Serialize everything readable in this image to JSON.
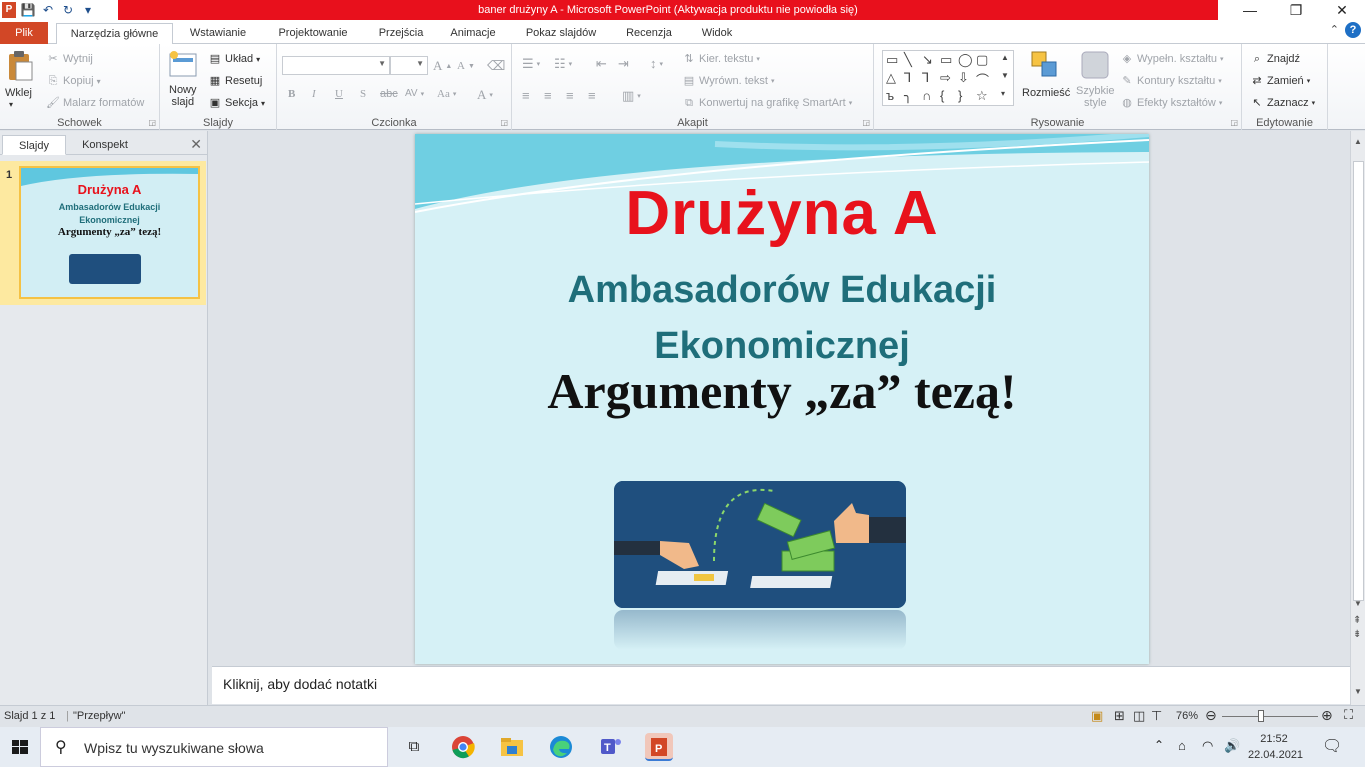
{
  "window": {
    "title": "baner drużyny A  -  Microsoft PowerPoint (Aktywacja produktu nie powiodła się)",
    "app_icon_letter": "P",
    "controls": {
      "minimize": "—",
      "restore": "❐",
      "close": "✕"
    }
  },
  "tabs": {
    "file": "Plik",
    "home": "Narzędzia główne",
    "insert": "Wstawianie",
    "design": "Projektowanie",
    "transitions": "Przejścia",
    "animations": "Animacje",
    "slideshow": "Pokaz slajdów",
    "review": "Recenzja",
    "view": "Widok"
  },
  "ribbon": {
    "clipboard": {
      "label": "Schowek",
      "paste": "Wklej",
      "cut": "Wytnij",
      "copy": "Kopiuj",
      "painter": "Malarz formatów"
    },
    "slides": {
      "label": "Slajdy",
      "new_slide_1": "Nowy",
      "new_slide_2": "slajd",
      "layout": "Układ",
      "reset": "Resetuj",
      "section": "Sekcja"
    },
    "font": {
      "label": "Czcionka",
      "bold": "B",
      "italic": "I",
      "underline": "U",
      "shadow": "S",
      "strike": "abc",
      "spacing": "AV",
      "case": "Aa",
      "grow": "A",
      "shrink": "A",
      "color": "A"
    },
    "paragraph": {
      "label": "Akapit",
      "text_direction": "Kier. tekstu",
      "align_text": "Wyrówn. tekst",
      "smartart": "Konwertuj na grafikę SmartArt"
    },
    "drawing": {
      "label": "Rysowanie",
      "arrange": "Rozmieść",
      "quick_styles_1": "Szybkie",
      "quick_styles_2": "style",
      "fill": "Wypełn. kształtu",
      "outline": "Kontury kształtu",
      "effects": "Efekty kształtów"
    },
    "editing": {
      "label": "Edytowanie",
      "find": "Znajdź",
      "replace": "Zamień",
      "select": "Zaznacz"
    }
  },
  "panel": {
    "tab_slides": "Slajdy",
    "tab_outline": "Konspekt",
    "close": "✕",
    "slide_number": "1"
  },
  "slide": {
    "title": "Drużyna  A",
    "subtitle_line1": "Ambasadorów Edukacji",
    "subtitle_line2": "Ekonomicznej",
    "argument": "Argumenty „za” tezą!"
  },
  "notes": {
    "placeholder": "Kliknij, aby dodać notatki"
  },
  "status": {
    "slide_count": "Slajd 1 z 1",
    "theme": "\"Przepływ\"",
    "zoom": "76%"
  },
  "taskbar": {
    "search_placeholder": "Wpisz tu wyszukiwane słowa",
    "time": "21:52",
    "date": "22.04.2021"
  },
  "colors": {
    "title_red": "#e8121c",
    "subtitle_teal": "#1f6e7a",
    "ppt_orange": "#d24726",
    "slide_bg": "#d6f1f6",
    "image_blue": "#1f4f7e"
  }
}
